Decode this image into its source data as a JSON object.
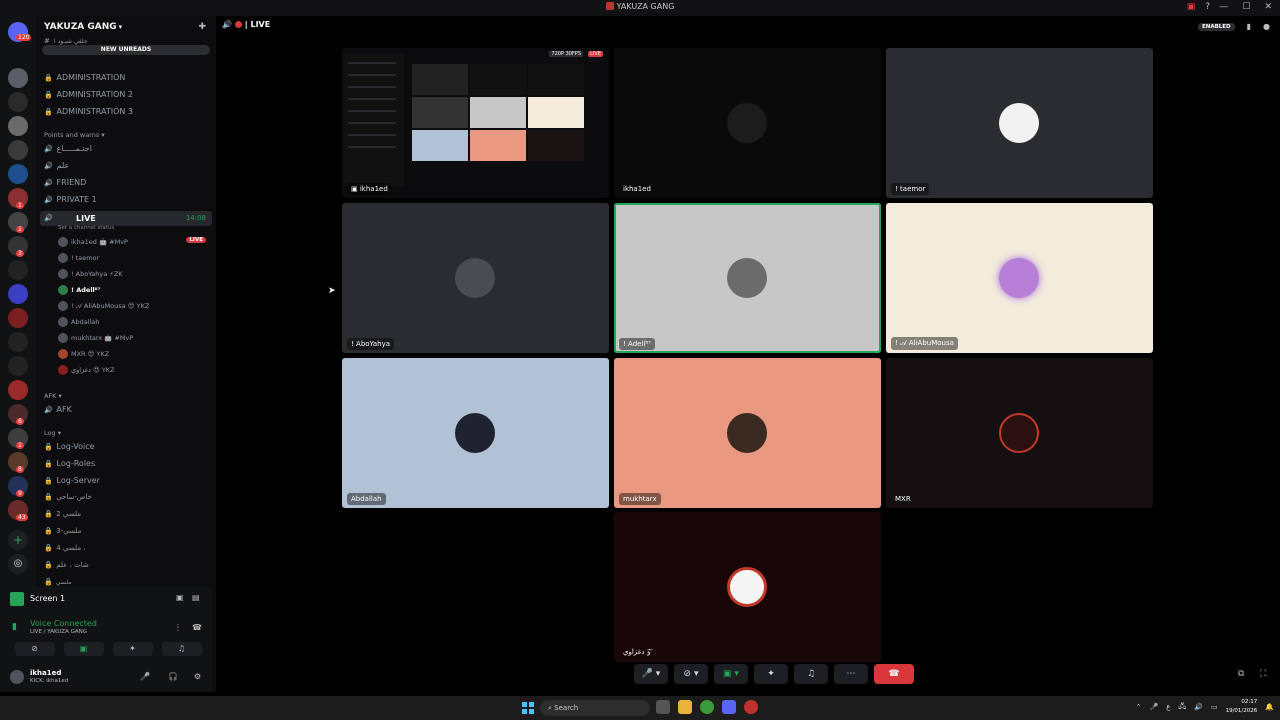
{
  "window": {
    "title": "YAKUZA GANG"
  },
  "servers": {
    "top_badge": "120",
    "badges": [
      "1",
      "2",
      "3",
      "6",
      "2",
      "8",
      "9",
      "43"
    ]
  },
  "sidebar": {
    "guild_name": "YAKUZA GANG",
    "top_channel": "حلقي شيـود ا",
    "new_unreads": "NEW UNREADS",
    "admin_channels": [
      "ADMINISTRATION",
      "ADMINISTRATION 2",
      "ADMINISTRATION 3"
    ],
    "category_points": "Points and warns",
    "voice_channels": [
      "اجتـمـــــاع",
      "علم",
      "FRIEND",
      "PRIVATE 1"
    ],
    "live_channel": {
      "name": "LIVE",
      "time": "14:08",
      "status": "Set a channel status",
      "live_badge": "LIVE"
    },
    "voice_users": [
      "ikha1ed 🤖 #MvP",
      "! taemor",
      "! AboYahya ⚡ZK",
      "! Adell⁸⁷",
      "! 𝒜 AliAbuMousa 😍 YKZ",
      "Abdallah",
      "mukhtarx 🤖 #MvP",
      "MXR 😍 YKZ",
      "دغزاوي 😍 YKZ"
    ],
    "category_afk": "AFK",
    "afk_channel": "AFK",
    "category_log": "Log",
    "log_channels": [
      "Log-Voice",
      "Log-Roles",
      "Log-Server",
      "خاص-ساحي",
      "ملسي 2",
      "ملسي-3",
      "ملسي 4 ،",
      "شات ، علم",
      "ملسي"
    ]
  },
  "panel": {
    "screen_label": "Screen 1",
    "voice_connected": "Voice Connected",
    "voice_sub": "LIVE / YAKUZA GANG",
    "username": "ikha1ed",
    "user_status": "KICK: ikha1ed"
  },
  "header": {
    "channel": "LIVE",
    "enabled": "ENABLED"
  },
  "stream": {
    "quality": "720P 30FPS",
    "live": "LIVE",
    "name": "ikha1ed"
  },
  "tiles": [
    "ikha1ed",
    "! taemor",
    "! AboYahya",
    "! Adell⁸⁷",
    "! 𝒜 AliAbuMousa",
    "Abdallah",
    "mukhtarx",
    "MXR",
    "دغزاوي 𝒵"
  ],
  "taskbar": {
    "search": "Search",
    "time": "02:17",
    "date": "19/01/2026",
    "lang": "ع"
  },
  "colors": {
    "accent_green": "#23a55a",
    "danger_red": "#da373c",
    "tile_peach": "#e8997f",
    "tile_blue": "#b1c2d4",
    "tile_cream": "#f3ebdc",
    "tile_grey": "#c7c7c7"
  }
}
